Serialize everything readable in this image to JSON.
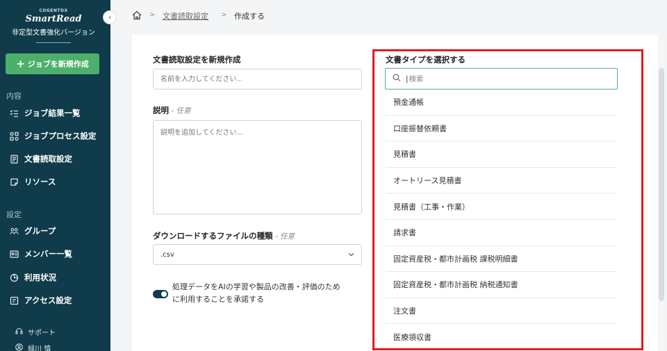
{
  "sidebar": {
    "brand_small": "COGENTDX",
    "brand_main": "SmartRead",
    "brand_sub": "非定型文書強化バージョン",
    "new_job_label": "ジョブを新規作成",
    "sections": {
      "content": "内容",
      "settings": "設定"
    },
    "items": [
      {
        "label": "ジョブ結果一覧",
        "icon": "list-check-icon"
      },
      {
        "label": "ジョブプロセス設定",
        "icon": "process-icon"
      },
      {
        "label": "文書読取設定",
        "icon": "document-icon"
      },
      {
        "label": "リソース",
        "icon": "resource-icon"
      },
      {
        "label": "グループ",
        "icon": "group-icon"
      },
      {
        "label": "メンバー一覧",
        "icon": "member-card-icon"
      },
      {
        "label": "利用状況",
        "icon": "pie-chart-icon"
      },
      {
        "label": "アクセス設定",
        "icon": "access-icon"
      }
    ],
    "footer": {
      "support": "サポート",
      "user": "緑川 慎"
    }
  },
  "breadcrumb": {
    "sep": ">",
    "link": "文書読取設定",
    "current": "作成する"
  },
  "form": {
    "name_label": "文書読取設定を新規作成",
    "name_placeholder": "名前を入力してください...",
    "desc_label": "説明",
    "desc_optional": " - 任意",
    "desc_placeholder": "説明を追加してください...",
    "download_label": "ダウンロードするファイルの種類",
    "download_optional": " - 任意",
    "download_value": ".csv",
    "consent_text_1": "処理データをAIの学習や製品の改善・評価のため",
    "consent_text_2": "に利用することを承諾する",
    "consent_enabled": true
  },
  "doc_type": {
    "title": "文書タイプを選択する",
    "search_placeholder": "検索",
    "options": [
      "預金通帳",
      "口座振替依頼書",
      "見積書",
      "オートリース見積書",
      "見積書（工事・作業）",
      "請求書",
      "固定資産税・都市計画税 課税明細書",
      "固定資産税・都市計画税 納税通知書",
      "注文書",
      "医療領収書"
    ]
  },
  "colors": {
    "sidebar_bg": "#0f3b4a",
    "primary_button": "#4caf6a",
    "highlight": "#e31b1b",
    "search_focus": "#5aa4a9"
  }
}
